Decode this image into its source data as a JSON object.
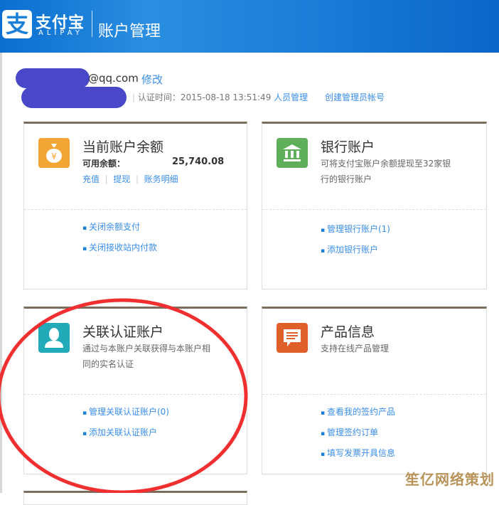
{
  "header": {
    "logo_cn": "支付宝",
    "logo_en": "ALIPAY",
    "logo_mark": "支",
    "title": "账户管理"
  },
  "account": {
    "email": "@qq.com",
    "edit_label": "修改",
    "verify_label": "认证时间：",
    "verify_time": "2015-08-18 13:51:49",
    "staff_link": "人员管理",
    "create_admin_link": "创建管理员帐号"
  },
  "cards": [
    {
      "title": "当前账户余额",
      "icon": "money-bag-icon",
      "color": "#f2a533",
      "balance_label": "可用余额：",
      "balance": "25,740.08",
      "actions": [
        "充值",
        "提现",
        "账务明细"
      ],
      "links": [
        "关闭余额支付",
        "关闭接收站内付款"
      ]
    },
    {
      "title": "银行账户",
      "icon": "bank-icon",
      "color": "#5fae5a",
      "desc": "可将支付宝账户余额提现至32家银行的银行账户",
      "links": [
        "管理银行账户(1)",
        "添加银行账户"
      ]
    },
    {
      "title": "关联认证账户",
      "icon": "user-icon",
      "color": "#22aab8",
      "desc": "通过与本账户关联获得与本账户相同的实名认证",
      "links": [
        "管理关联认证账户(0)",
        "添加关联认证账户"
      ]
    },
    {
      "title": "产品信息",
      "icon": "message-icon",
      "color": "#e0602a",
      "desc": "支持在线产品管理",
      "links": [
        "查看我的签约产品",
        "管理签约订单",
        "填写发票开具信息"
      ]
    }
  ],
  "annotation_color": "#f03030",
  "watermark": "笙亿网络策划"
}
